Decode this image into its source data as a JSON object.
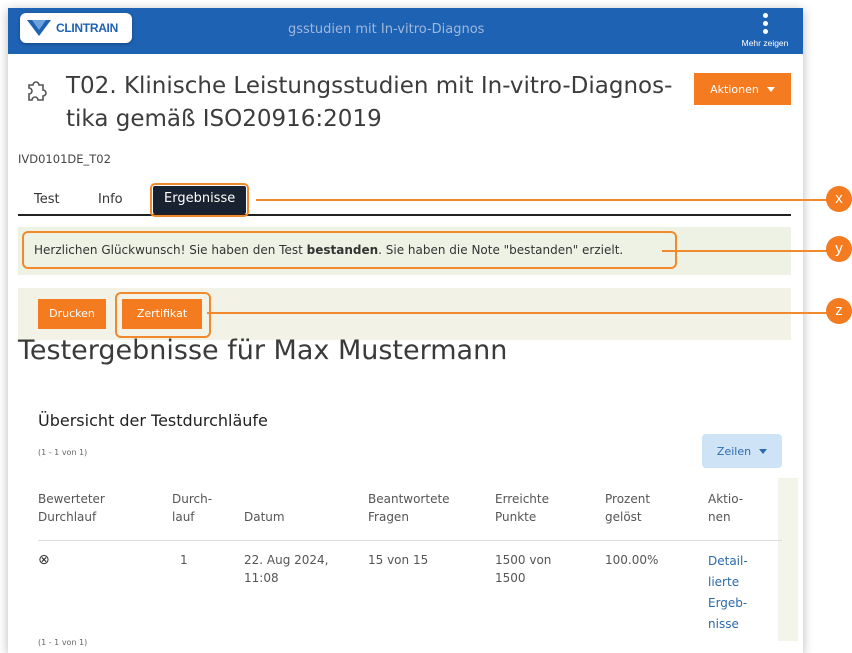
{
  "topbar": {
    "logo_text": "CLINTRAIN",
    "title": "gsstudien mit In-vitro-Diagnos",
    "more_label": "Mehr zeigen"
  },
  "header": {
    "title": "T02. Klinische Leistungsstudien mit In-vitro-Diagnos-tika gemäß ISO20916:2019",
    "actions_label": "Aktionen",
    "course_id": "IVD0101DE_T02"
  },
  "tabs": [
    "Test",
    "Info",
    "Ergebnisse"
  ],
  "success": {
    "pre": "Herzlichen Glückwunsch! Sie haben den Test ",
    "bold": "bestanden",
    "post": ". Sie haben die Note \"bestanden\" erzielt."
  },
  "buttons": {
    "print": "Drucken",
    "certificate": "Zertifikat"
  },
  "results": {
    "heading": "Testergebnisse für Max Mustermann",
    "subheading": "Übersicht der Testdurchläufe",
    "range_top": "(1 - 1 von 1)",
    "range_bottom": "(1 - 1 von 1)",
    "rows_button": "Zeilen",
    "columns": [
      "Bewerteter Durchlauf",
      "Durch- lauf",
      "Datum",
      "Beantwortete Fragen",
      "Erreichte Punkte",
      "Prozent gelöst",
      "Aktio- nen"
    ],
    "row": {
      "rated_icon": "⊗",
      "run": "1",
      "date": "22. Aug 2024, 11:08",
      "answered": "15 von 15",
      "points": "1500 von 1500",
      "percent": "100.00%",
      "action": "Detail- lierte Ergeb- nisse"
    }
  },
  "callouts": [
    "x",
    "y",
    "z"
  ],
  "colors": {
    "topbar": "#1e62b3",
    "accent": "#f47b20",
    "tab_active": "#192230"
  }
}
